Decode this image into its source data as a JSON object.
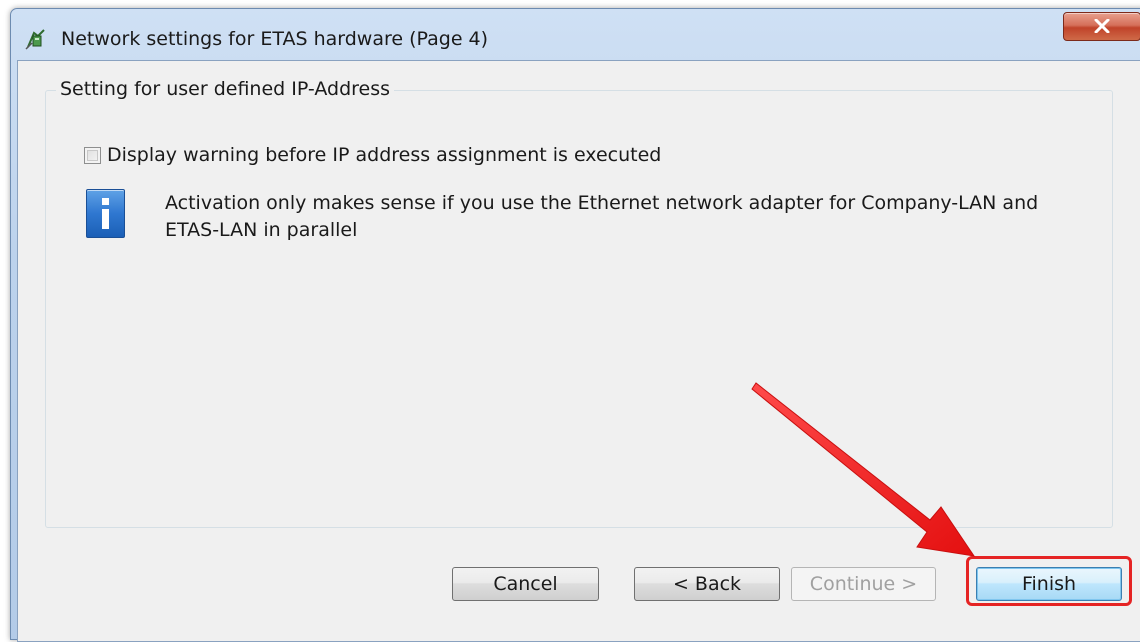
{
  "window": {
    "title": "Network settings for ETAS hardware (Page 4)"
  },
  "group": {
    "title": "Setting for user defined IP-Address"
  },
  "checkbox": {
    "label": "Display warning before IP address assignment is executed",
    "checked": false
  },
  "info": {
    "icon": "info-icon",
    "text_line1": "Activation only makes sense if you use the Ethernet network adapter for Company-LAN and",
    "text_line2": "ETAS-LAN in parallel"
  },
  "buttons": {
    "cancel": "Cancel",
    "back": "< Back",
    "continue": "Continue >",
    "finish": "Finish"
  },
  "annotation": {
    "highlight_color": "#e52424",
    "target": "Finish"
  }
}
